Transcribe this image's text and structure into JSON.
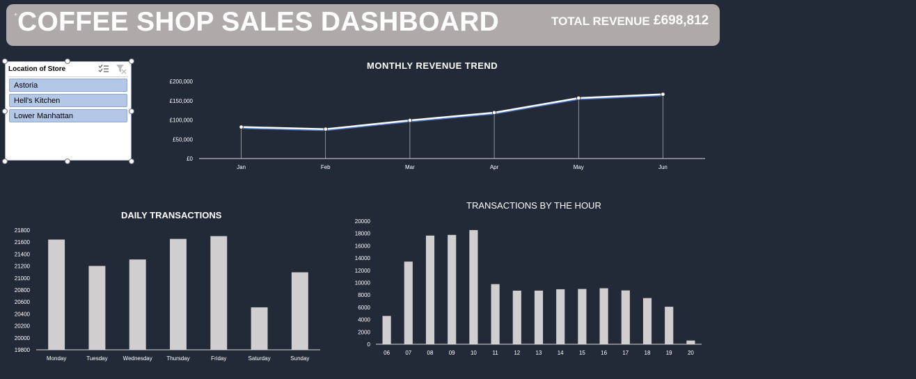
{
  "header": {
    "title": "COFFEE SHOP SALES DASHBOARD",
    "total_revenue_label": "TOTAL REVENUE",
    "total_revenue_value": "£698,812"
  },
  "slicer": {
    "title": "Location of Store",
    "items": [
      "Astoria",
      "Hell's Kitchen",
      "Lower Manhattan"
    ]
  },
  "colors": {
    "background": "#222a37",
    "header": "#aeaaaa",
    "bar": "#d0cece",
    "line": "#ffffff",
    "line_shadow": "#4472c4",
    "slicer_item": "#b4c7e7"
  },
  "chart_data": [
    {
      "type": "line",
      "title": "MONTHLY REVENUE TREND",
      "categories": [
        "Jan",
        "Feb",
        "Mar",
        "Apr",
        "May",
        "Jun"
      ],
      "values": [
        81678,
        76145,
        98835,
        118941,
        156728,
        166486
      ],
      "ylim": [
        0,
        200000
      ],
      "yticks": [
        "£0",
        "£50,000",
        "£100,000",
        "£150,000",
        "£200,000"
      ],
      "grid": false
    },
    {
      "type": "bar",
      "title": "DAILY TRANSACTIONS",
      "categories": [
        "Monday",
        "Tuesday",
        "Wednesday",
        "Thursday",
        "Friday",
        "Saturday",
        "Sunday"
      ],
      "values": [
        21643,
        21202,
        21310,
        21654,
        21701,
        20510,
        21096
      ],
      "ylim": [
        19800,
        21800
      ],
      "yticks": [
        "19800",
        "20000",
        "20200",
        "20400",
        "20600",
        "20800",
        "21000",
        "21200",
        "21400",
        "21600",
        "21800"
      ],
      "grid": false
    },
    {
      "type": "bar",
      "title": "TRANSACTIONS BY THE HOUR",
      "categories": [
        "06",
        "07",
        "08",
        "09",
        "10",
        "11",
        "12",
        "13",
        "14",
        "15",
        "16",
        "17",
        "18",
        "19",
        "20"
      ],
      "values": [
        4594,
        13428,
        17654,
        17764,
        18545,
        9766,
        8708,
        8714,
        8933,
        8979,
        9093,
        8745,
        7498,
        6092,
        603
      ],
      "ylim": [
        0,
        20000
      ],
      "yticks": [
        "0",
        "2000",
        "4000",
        "6000",
        "8000",
        "10000",
        "12000",
        "14000",
        "16000",
        "18000",
        "20000"
      ],
      "grid": false
    }
  ]
}
